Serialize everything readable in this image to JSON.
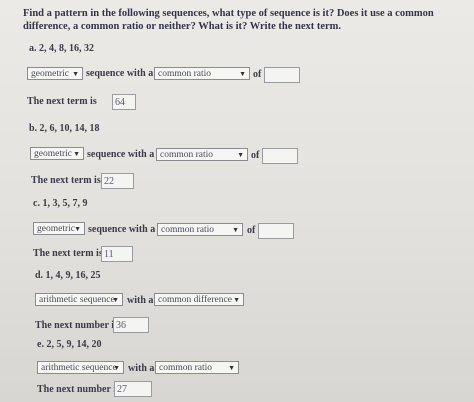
{
  "question": "Find a pattern in the following sequences, what type of sequence is it? Does it use a common difference, a common ratio or neither? What is it? Write the next term.",
  "sequence_with_label": "sequence with a",
  "of_label": "of",
  "next_term_label": "The next term is",
  "next_number_label": "The next number is",
  "with_a_label": "with a",
  "items": [
    {
      "label": "a. 2, 4, 8, 16, 32",
      "type": "geometric",
      "rule": "common ratio",
      "of_value": "",
      "next": "64"
    },
    {
      "label": "b. 2, 6, 10, 14, 18",
      "type": "geometric",
      "rule": "common ratio",
      "of_value": "",
      "next": "22"
    },
    {
      "label": "c. 1, 3, 5, 7, 9",
      "type": "geometric",
      "rule": "common ratio",
      "of_value": "",
      "next": "11"
    },
    {
      "label": "d. 1, 4, 9, 16, 25",
      "type": "arithmetic sequence",
      "rule": "common difference",
      "next": "36"
    },
    {
      "label": "e. 2, 5, 9, 14, 20",
      "type": "arithmetic sequence",
      "rule": "common ratio",
      "next": "27"
    }
  ]
}
